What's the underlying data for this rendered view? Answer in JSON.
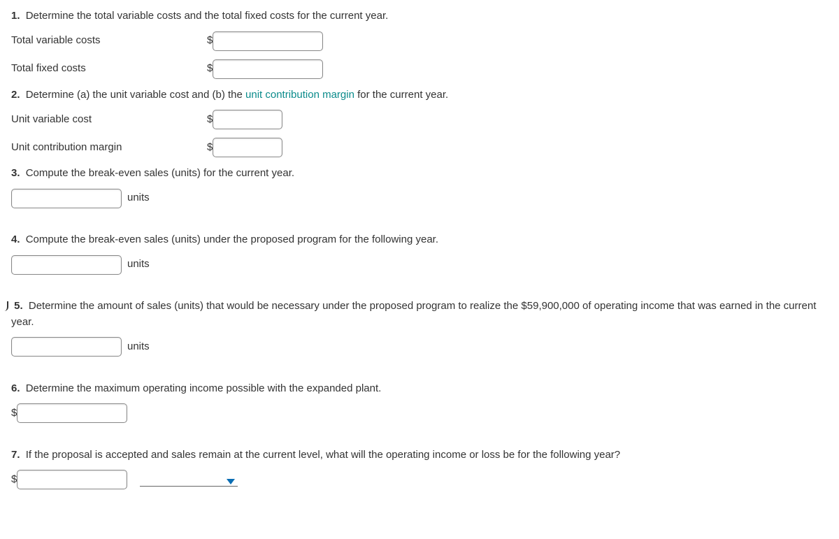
{
  "q1": {
    "num": "1.",
    "prompt": "Determine the total variable costs and the total fixed costs for the current year.",
    "rowA_label": "Total variable costs",
    "rowB_label": "Total fixed costs",
    "currency": "$"
  },
  "q2": {
    "num": "2.",
    "prompt_a": "Determine (a) the unit variable cost and (b) the ",
    "prompt_link": "unit contribution margin",
    "prompt_b": " for the current year.",
    "rowA_label": "Unit variable cost",
    "rowB_label": "Unit contribution margin",
    "currency": "$"
  },
  "q3": {
    "num": "3.",
    "prompt": "Compute the break-even sales (units) for the current year.",
    "unit_label": "units"
  },
  "q4": {
    "num": "4.",
    "prompt": "Compute the break-even sales (units) under the proposed program for the following year.",
    "unit_label": "units"
  },
  "q5": {
    "num": "5.",
    "prompt": "Determine the amount of sales (units) that would be necessary under the proposed program to realize the $59,900,000 of operating income that was earned in the current year.",
    "unit_label": "units"
  },
  "q6": {
    "num": "6.",
    "prompt": "Determine the maximum operating income possible with the expanded plant.",
    "currency": "$"
  },
  "q7": {
    "num": "7.",
    "prompt": "If the proposal is accepted and sales remain at the current level, what will the operating income or loss be for the following year?",
    "currency": "$"
  }
}
